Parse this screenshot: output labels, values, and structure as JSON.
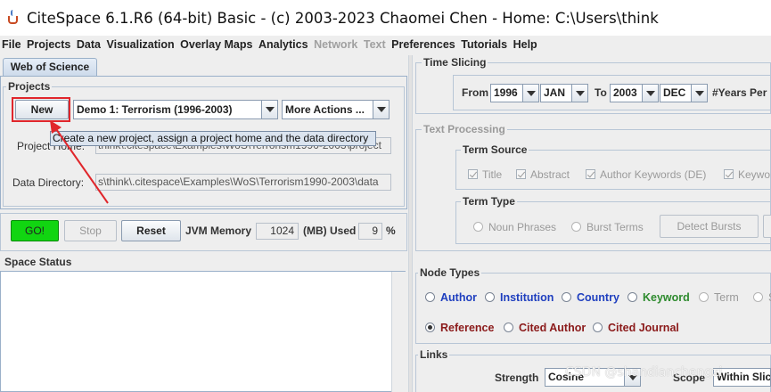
{
  "window": {
    "title": "CiteSpace 6.1.R6 (64-bit) Basic - (c) 2003-2023 Chaomei Chen - Home: C:\\Users\\think"
  },
  "menu": [
    {
      "label": "File",
      "enabled": true
    },
    {
      "label": "Projects",
      "enabled": true
    },
    {
      "label": "Data",
      "enabled": true
    },
    {
      "label": "Visualization",
      "enabled": true
    },
    {
      "label": "Overlay Maps",
      "enabled": true
    },
    {
      "label": "Analytics",
      "enabled": true
    },
    {
      "label": "Network",
      "enabled": false
    },
    {
      "label": "Text",
      "enabled": false
    },
    {
      "label": "Preferences",
      "enabled": true
    },
    {
      "label": "Tutorials",
      "enabled": true
    },
    {
      "label": "Help",
      "enabled": true
    }
  ],
  "left": {
    "tab": "Web of Science",
    "projects_title": "Projects",
    "new_button": "New",
    "project_select": "Demo 1: Terrorism (1996-2003)",
    "more_actions": "More Actions ...",
    "tooltip": "Create a new project, assign a project home and the data directory",
    "project_home_label": "Project Home:",
    "project_home_value": "think\\.citespace\\Examples\\WoS\\Terrorism1990-2003\\project",
    "data_dir_label": "Data Directory:",
    "data_dir_value": "s\\think\\.citespace\\Examples\\WoS\\Terrorism1990-2003\\data",
    "go_button": "GO!",
    "stop_button": "Stop",
    "reset_button": "Reset",
    "jvm_label": "JVM Memory",
    "jvm_value": "1024",
    "mb_used_label": "(MB) Used",
    "used_value": "9",
    "percent": "%",
    "space_status_title": "Space Status"
  },
  "time_slicing": {
    "title": "Time Slicing",
    "from_label": "From",
    "from_year": "1996",
    "from_month": "JAN",
    "to_label": "To",
    "to_year": "2003",
    "to_month": "DEC",
    "years_per": "#Years Per"
  },
  "text_processing": {
    "title": "Text Processing",
    "term_source_title": "Term Source",
    "sources": [
      "Title",
      "Abstract",
      "Author Keywords (DE)",
      "Keywo"
    ],
    "term_type_title": "Term Type",
    "noun_phrases": "Noun Phrases",
    "burst_terms": "Burst Terms",
    "detect_bursts": "Detect Bursts"
  },
  "node_types": {
    "title": "Node Types",
    "row1": [
      {
        "label": "Author",
        "color": "#1f3fbf",
        "selected": false
      },
      {
        "label": "Institution",
        "color": "#1f3fbf",
        "selected": false
      },
      {
        "label": "Country",
        "color": "#1f3fbf",
        "selected": false
      },
      {
        "label": "Keyword",
        "color": "#2e8b2e",
        "selected": false
      },
      {
        "label": "Term",
        "color": "#9a9a9a",
        "selected": false
      },
      {
        "label": "S",
        "color": "#9a9a9a",
        "selected": false
      }
    ],
    "row2": [
      {
        "label": "Reference",
        "color": "#8b1a1a",
        "selected": true
      },
      {
        "label": "Cited Author",
        "color": "#8b1a1a",
        "selected": false
      },
      {
        "label": "Cited Journal",
        "color": "#8b1a1a",
        "selected": false
      }
    ]
  },
  "links": {
    "title": "Links",
    "strength_label": "Strength",
    "strength_value": "Cosine",
    "scope_label": "Scope",
    "scope_value": "Within Slices"
  },
  "watermark": "CSDN @shandianchengzi"
}
